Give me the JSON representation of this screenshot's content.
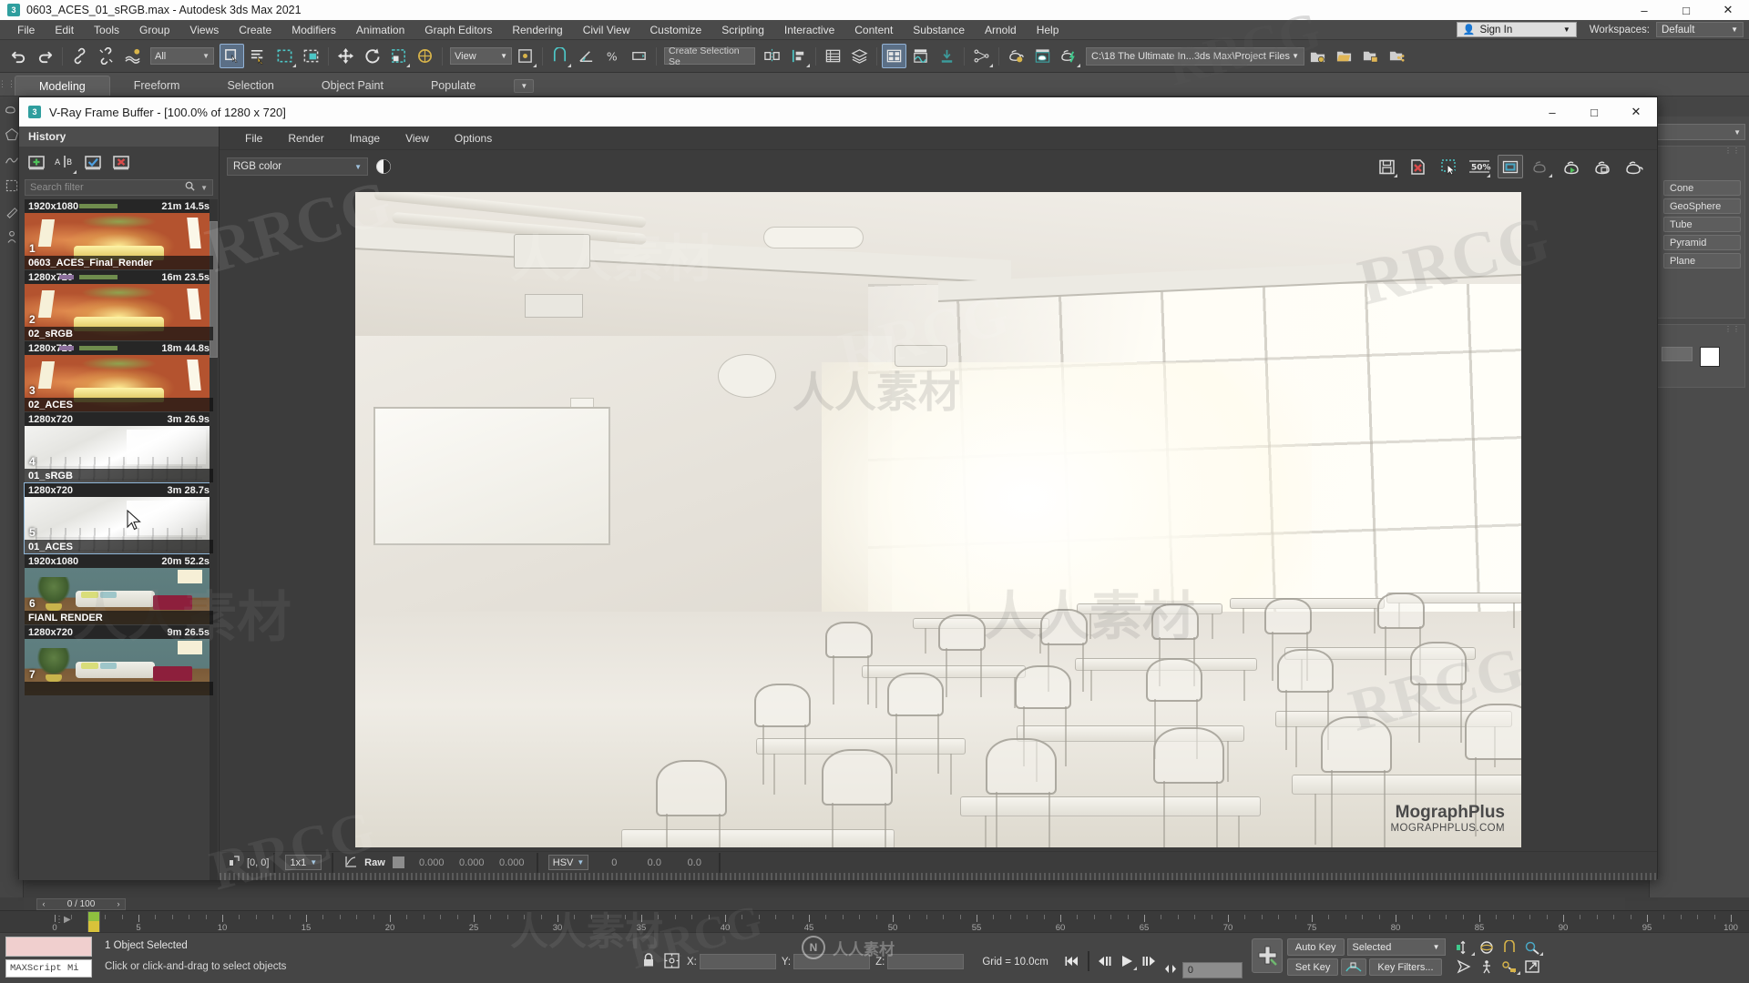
{
  "titlebar": {
    "app_icon": "3ds-max-icon",
    "title": "0603_ACES_01_sRGB.max - Autodesk 3ds Max 2021",
    "minimize": "–",
    "maximize": "□",
    "close": "✕"
  },
  "menubar": {
    "items": [
      {
        "label": "File"
      },
      {
        "label": "Edit"
      },
      {
        "label": "Tools"
      },
      {
        "label": "Group"
      },
      {
        "label": "Views"
      },
      {
        "label": "Create"
      },
      {
        "label": "Modifiers"
      },
      {
        "label": "Animation"
      },
      {
        "label": "Graph Editors"
      },
      {
        "label": "Rendering"
      },
      {
        "label": "Civil View"
      },
      {
        "label": "Customize"
      },
      {
        "label": "Scripting"
      },
      {
        "label": "Interactive"
      },
      {
        "label": "Content"
      },
      {
        "label": "Substance"
      },
      {
        "label": "Arnold"
      },
      {
        "label": "Help"
      }
    ],
    "sign_in": "Sign In",
    "workspaces_label": "Workspaces:",
    "workspace_value": "Default",
    "caret": "▼"
  },
  "toolbar": {
    "selection_set_filter": "All",
    "named_selection_placeholder": "Create Selection Se",
    "view_dropdown": "View",
    "project_path": "C:\\18 The Ultimate In...3ds Max\\Project Files",
    "caret": "▼"
  },
  "ribbon": {
    "tabs": [
      {
        "label": "Modeling",
        "selected": true
      },
      {
        "label": "Freeform",
        "selected": false
      },
      {
        "label": "Selection",
        "selected": false
      },
      {
        "label": "Object Paint",
        "selected": false
      },
      {
        "label": "Populate",
        "selected": false
      }
    ],
    "minimize_caret": "▼"
  },
  "right_panel": {
    "dropdown_value": "",
    "object_buttons": [
      "Cone",
      "GeoSphere",
      "Tube",
      "Pyramid",
      "Plane"
    ]
  },
  "vfb": {
    "app_icon": "3ds-max-icon",
    "title": "V-Ray Frame Buffer - [100.0% of 1280 x 720]",
    "minimize": "–",
    "maximize": "□",
    "close": "✕",
    "menu": [
      {
        "label": "File"
      },
      {
        "label": "Render"
      },
      {
        "label": "Image"
      },
      {
        "label": "View"
      },
      {
        "label": "Options"
      }
    ],
    "channel_select": "RGB color",
    "channel_caret": "▼",
    "zoom_level": "50 %",
    "toolbar_icons": [
      "save-image-icon",
      "clear-image-icon",
      "region-render-icon",
      "zoom-level-icon",
      "fit-to-window-icon",
      "render-last-icon",
      "render-play-icon",
      "render-region-icon",
      "render-teapot-icon"
    ],
    "history": {
      "title": "History",
      "tool_icons": [
        "add-to-history-icon",
        "ab-compare-icon",
        "load-history-icon",
        "delete-history-icon"
      ],
      "search_placeholder": "Search filter",
      "search_icon": "🔍",
      "search_caret": "▼",
      "items": [
        {
          "index": "1",
          "resolution": "1920x1080",
          "time": "21m 14.5s",
          "name": "0603_ACES_Final_Render",
          "thumb": "warm-sofa",
          "selected": false,
          "green_bar": true,
          "purple_bar": false
        },
        {
          "index": "2",
          "resolution": "1280x720",
          "time": "16m 23.5s",
          "name": "02_sRGB",
          "thumb": "warm-sofa",
          "selected": false,
          "green_bar": true,
          "purple_bar": true
        },
        {
          "index": "3",
          "resolution": "1280x720",
          "time": "18m 44.8s",
          "name": "02_ACES",
          "thumb": "warm-sofa",
          "selected": false,
          "green_bar": true,
          "purple_bar": true
        },
        {
          "index": "4",
          "resolution": "1280x720",
          "time": "3m 26.9s",
          "name": "01_sRGB",
          "thumb": "classroom",
          "selected": false,
          "green_bar": false,
          "purple_bar": false
        },
        {
          "index": "5",
          "resolution": "1280x720",
          "time": "3m 28.7s",
          "name": "01_ACES",
          "thumb": "classroom",
          "selected": true,
          "green_bar": false,
          "purple_bar": false
        },
        {
          "index": "6",
          "resolution": "1920x1080",
          "time": "20m 52.2s",
          "name": "FIANL RENDER",
          "thumb": "living",
          "selected": false,
          "green_bar": false,
          "purple_bar": false
        },
        {
          "index": "7",
          "resolution": "1280x720",
          "time": "9m 26.5s",
          "name": "",
          "thumb": "living",
          "selected": false,
          "green_bar": false,
          "purple_bar": false
        }
      ]
    },
    "status": {
      "pixel_coord": "[0, 0]",
      "sample_size": "1x1",
      "raw_label": "Raw",
      "raw_values": [
        "0.000",
        "0.000",
        "0.000"
      ],
      "color_mode": "HSV",
      "hsv_values": [
        "0",
        "0.0",
        "0.0"
      ],
      "caret": "▼"
    },
    "watermark": {
      "line1_light": "Mograph",
      "line1_bold": "Plus",
      "line2": "MOGRAPHPLUS.COM"
    }
  },
  "timeline": {
    "frame_display": "0 / 100",
    "prev_arrow": "‹",
    "next_arrow": "›",
    "tick_labels": [
      "0",
      "5",
      "10",
      "15",
      "20",
      "25",
      "30",
      "35",
      "40",
      "45",
      "50",
      "55",
      "60",
      "65",
      "70",
      "75",
      "80",
      "85",
      "90",
      "95",
      "100"
    ],
    "range_start": 0,
    "range_end": 100
  },
  "statusbar": {
    "maxscript_label": "MAXScript Mi",
    "selection_status": "1 Object Selected",
    "prompt": "Click or click-and-drag to select objects",
    "coord_x_label": "X:",
    "coord_y_label": "Y:",
    "coord_z_label": "Z:",
    "coord_x_value": "",
    "coord_y_value": "",
    "coord_z_value": "",
    "grid": "Grid = 10.0cm",
    "add_time_tag": "Add Time Tag",
    "frame_field": "0",
    "auto_key": "Auto Key",
    "set_key": "Set Key",
    "key_filters": "Key Filters...",
    "selected_filter": "Selected",
    "caret": "▼"
  },
  "watermarks": {
    "latin": "RRCG",
    "chinese": "人人素材",
    "center_logo_letter": "N",
    "center_logo_text": "人人素材"
  }
}
